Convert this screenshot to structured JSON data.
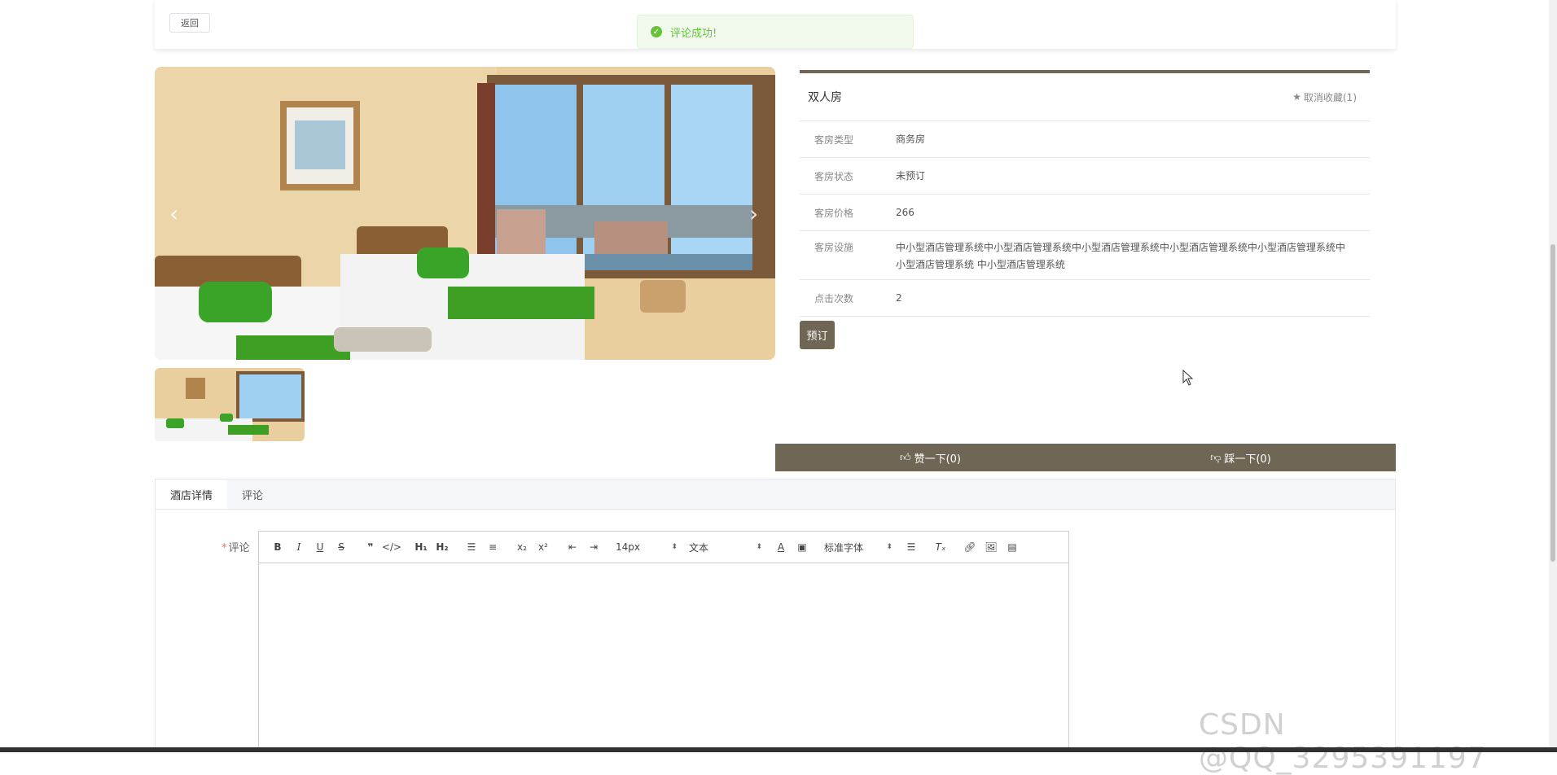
{
  "header": {
    "back_label": "返回"
  },
  "toast": {
    "message": "评论成功!"
  },
  "room": {
    "name": "双人房",
    "favorite_label": "取消收藏(1)",
    "details": [
      {
        "label": "客房类型",
        "value": "商务房"
      },
      {
        "label": "客房状态",
        "value": "未预订"
      },
      {
        "label": "客房价格",
        "value": "266"
      },
      {
        "label": "客房设施",
        "value": "中小型酒店管理系统中小型酒店管理系统中小型酒店管理系统中小型酒店管理系统中小型酒店管理系统中小型酒店管理系统 中小型酒店管理系统"
      },
      {
        "label": "点击次数",
        "value": "2"
      }
    ],
    "book_label": "预订"
  },
  "votes": {
    "like_label": "赞一下(0)",
    "dislike_label": "踩一下(0)"
  },
  "tabs": [
    {
      "label": "酒店详情"
    },
    {
      "label": "评论"
    }
  ],
  "comment": {
    "label": "评论",
    "required_mark": "*",
    "toolbar": {
      "font_size": "14px",
      "header": "文本",
      "font_family": "标准字体"
    }
  },
  "watermark": "CSDN @QQ_3295391197",
  "colors": {
    "accent": "#6f6655",
    "success": "#67c23a"
  }
}
